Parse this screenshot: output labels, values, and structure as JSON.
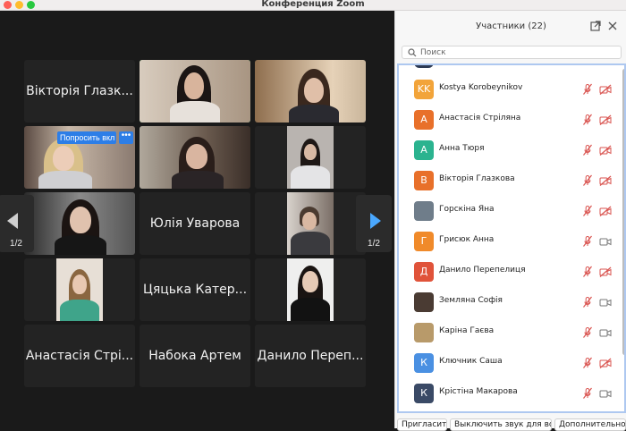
{
  "window": {
    "title": "Конференция Zoom"
  },
  "video": {
    "tiles": [
      {
        "name": "Вікторія Глазк..."
      },
      {
        "name": "Юлія Уварова"
      },
      {
        "name": "Цяцька Катер..."
      },
      {
        "name": "Анастасія Стрі..."
      },
      {
        "name": "Набока Артем"
      },
      {
        "name": "Данило Переп..."
      }
    ],
    "ask_button": "Попросить вкл",
    "more_button": "•••",
    "page_left": "1/2",
    "page_right": "1/2"
  },
  "panel": {
    "title": "Участники (22)",
    "search_placeholder": "Поиск",
    "participants": [
      {
        "name": "Kostya Korobeynikov",
        "initials": "KK",
        "color": "#f2a43a",
        "mic": "muted",
        "cam": "off"
      },
      {
        "name": "Анастасія Стріляна",
        "initials": "А",
        "color": "#e8702a",
        "mic": "muted",
        "cam": "off"
      },
      {
        "name": "Анна Тюря",
        "initials": "А",
        "color": "#2bb38f",
        "mic": "muted",
        "cam": "off"
      },
      {
        "name": "Вікторія Глазкова",
        "initials": "В",
        "color": "#e8702a",
        "mic": "muted",
        "cam": "off"
      },
      {
        "name": "Горскіна Яна",
        "initials": "",
        "color": "#6f7d8a",
        "mic": "muted",
        "cam": "off"
      },
      {
        "name": "Грисюк Анна",
        "initials": "Г",
        "color": "#f08a2a",
        "mic": "muted",
        "cam": "on"
      },
      {
        "name": "Данило Перепелиця",
        "initials": "Д",
        "color": "#e0533a",
        "mic": "muted",
        "cam": "off"
      },
      {
        "name": "Землянa Софія",
        "initials": "",
        "color": "#4a3b33",
        "mic": "muted",
        "cam": "on"
      },
      {
        "name": "Каріна Гаєва",
        "initials": "",
        "color": "#b89a6a",
        "mic": "muted",
        "cam": "on"
      },
      {
        "name": "Ключник Саша",
        "initials": "К",
        "color": "#4a90e2",
        "mic": "muted",
        "cam": "off"
      },
      {
        "name": "Крістіна Макарова",
        "initials": "К",
        "color": "#3a4a66",
        "mic": "muted",
        "cam": "on"
      }
    ],
    "footer": {
      "invite": "Пригласить",
      "mute_all": "Выключить звук для всех",
      "more": "Дополнительно"
    }
  }
}
